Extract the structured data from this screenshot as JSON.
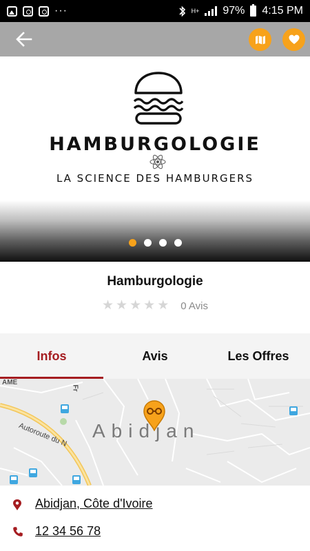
{
  "status_bar": {
    "left_icons": [
      "image-icon",
      "instagram-icon",
      "instagram-icon"
    ],
    "overflow": "···",
    "network": "H+",
    "battery_pct": "97%",
    "time": "4:15 PM"
  },
  "app_bar": {
    "back_icon": "arrow-left-icon",
    "map_icon": "map-icon",
    "favorite_icon": "heart-icon",
    "accent_color": "#f7a21b"
  },
  "hero": {
    "brand_title": "HAMBURGOLOGIE",
    "brand_tagline": "LA SCIENCE DES HAMBURGERS",
    "carousel": {
      "count": 4,
      "active_index": 0
    }
  },
  "place": {
    "name": "Hamburgologie",
    "rating_stars": 0,
    "rating_max": 5,
    "reviews": "0 Avis"
  },
  "tabs": [
    {
      "label": "Infos",
      "active": true
    },
    {
      "label": "Avis",
      "active": false
    },
    {
      "label": "Les Offres",
      "active": false
    }
  ],
  "tab_active_color": "#a51c20",
  "map": {
    "city": "Abidjan",
    "road": "Autoroute du N",
    "corner_label": "AME",
    "side_label": "Fr"
  },
  "contact": {
    "address": "Abidjan, Côte d'Ivoire",
    "phone": "12 34 56 78",
    "icon_color": "#a51c20"
  }
}
